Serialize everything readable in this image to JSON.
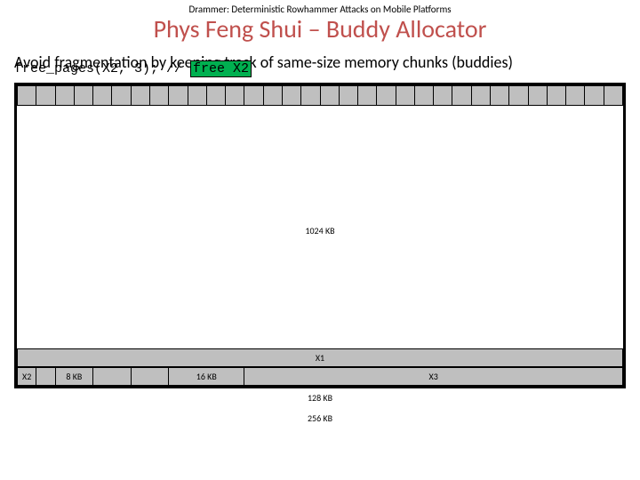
{
  "header": {
    "doc_title": "Drammer: Deterministic Rowhammer Attacks on Mobile Platforms",
    "slide_title": "Phys Feng Shui – Buddy Allocator"
  },
  "body": {
    "desc": "Avoid fragmentation by keeping track of same-size memory chunks (buddies)",
    "code_prefix": "free_pages(X2, 3); // ",
    "code_highlight": "free X2"
  },
  "diagram": {
    "kb_1024": "1024 KB",
    "x1": "X1",
    "x2": "X2",
    "kb_8": "8 KB",
    "kb_16": "16 KB",
    "x3": "X3",
    "kb_128": "128 KB",
    "kb_256": "256 KB"
  }
}
